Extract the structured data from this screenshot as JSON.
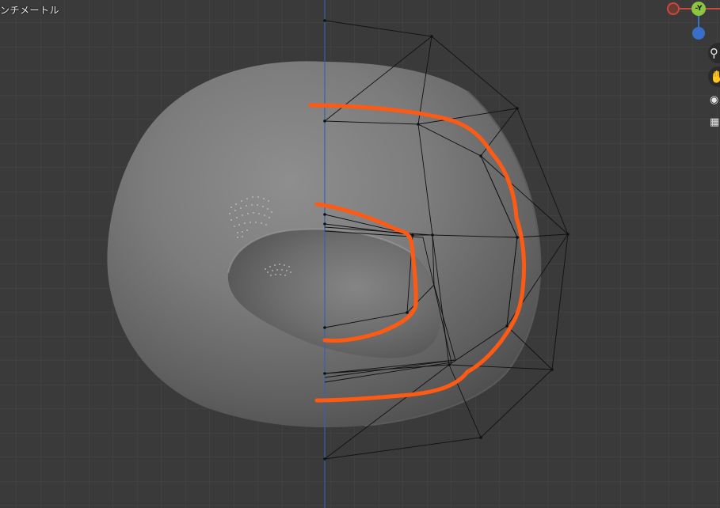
{
  "viewport": {
    "unit_label": "ンチメートル",
    "background_color": "#3a3a3a",
    "grid_color": "#4a4a4a"
  },
  "navigation_gizmo": {
    "y_axis_label": "-Y",
    "x_axis_color": "#c84a3a",
    "y_axis_color": "#8cc63f",
    "z_axis_color": "#3a6fc8"
  },
  "toolbar": {
    "zoom_icon": "magnifier-icon",
    "pan_icon": "hand-icon",
    "camera_icon": "camera-icon",
    "grid_icon": "grid-view-icon"
  },
  "annotations": {
    "stroke_color": "#ff5a14"
  },
  "mesh": {
    "cage_color": "#111111",
    "mirror_axis_color": "#3b5fb5"
  }
}
